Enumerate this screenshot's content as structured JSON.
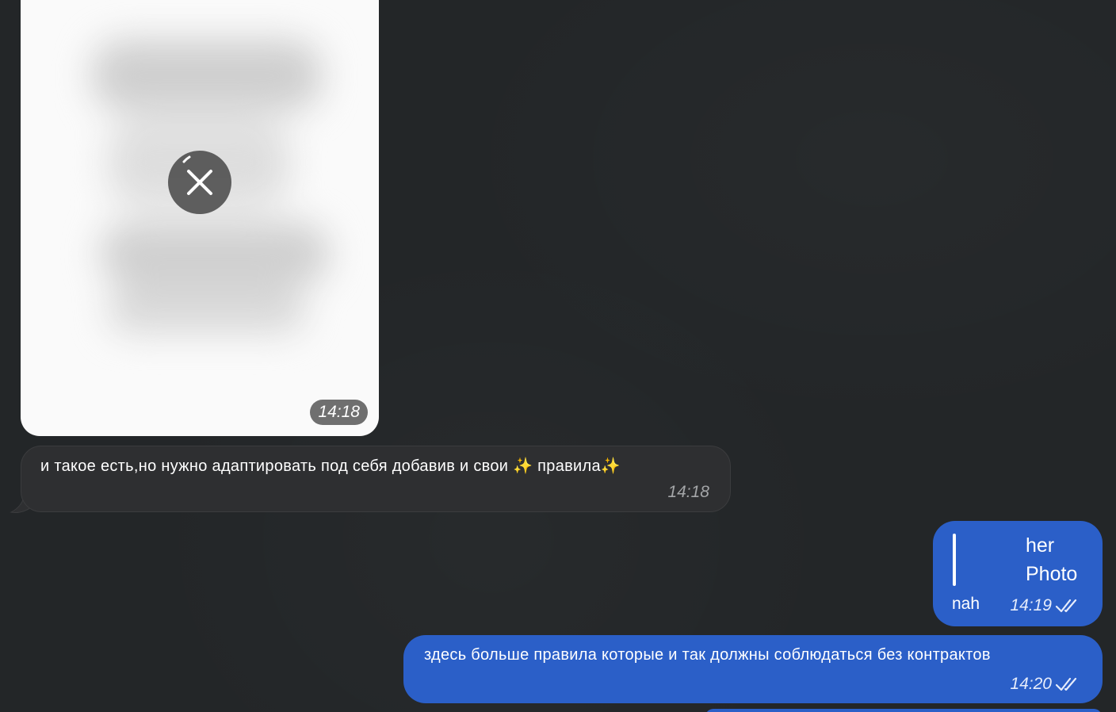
{
  "messages": {
    "photo": {
      "time": "14:18"
    },
    "incoming_text": {
      "text": "и такое есть,но нужно адаптировать под себя добавив и свои ✨ правила✨",
      "time": "14:18"
    },
    "reply": {
      "quoted_name": "her",
      "quoted_type": "Photo",
      "text": "nah",
      "time": "14:19",
      "status_icon": "double-check-icon"
    },
    "outgoing_text": {
      "text": "здесь больше правила которые и так должны соблюдаться без контрактов",
      "time": "14:20",
      "status_icon": "double-check-icon"
    }
  },
  "colors": {
    "background": "#232628",
    "incoming_bubble": "#2e2f31",
    "outgoing_bubble": "#2b5fc8",
    "photo_background": "#fafafa"
  }
}
